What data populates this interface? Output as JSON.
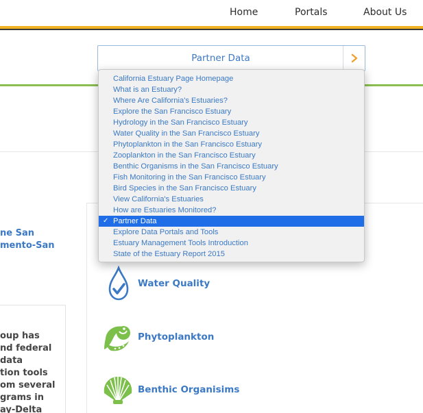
{
  "nav": {
    "home": "Home",
    "portals": "Portals",
    "about": "About Us"
  },
  "selector": {
    "label": "Partner Data",
    "arrow_icon": "chevron-right-icon",
    "arrow_color": "#f0a030"
  },
  "dropdown": {
    "options": [
      "California Estuary Page Homepage",
      "What is an Estuary?",
      "Where Are California's Estuaries?",
      "Explore the San Francisco Estuary",
      "Hydrology in the San Francisco Estuary",
      "Water Quality in the San Francisco Estuary",
      "Phytoplankton in the San Francisco Estuary",
      "Zooplankton in the San Francisco Estuary",
      "Benthic Organisms in the San Francisco Estuary",
      "Fish Monitoring in the San Francisco Estuary",
      "Bird Species in the San Francisco Estuary",
      "View California's Estuaries",
      "How are Estuaries Monitored?",
      "Partner Data",
      "Explore Data Portals and Tools",
      "Estuary Management Tools Introduction",
      "State of the Estuary Report 2015"
    ],
    "selected": "Partner Data",
    "check": "✓"
  },
  "left": {
    "heading_line1": "ne San",
    "heading_line2": "mento-San",
    "body_lines": [
      "oup has",
      "nd federal",
      "data",
      "tion tools",
      "om several",
      "grams in",
      "ay-Delta"
    ]
  },
  "card": {
    "items": [
      {
        "label": "Water Quality",
        "icon": "water-drop-check-icon"
      },
      {
        "label": "Phytoplankton",
        "icon": "phytoplankton-icon"
      },
      {
        "label": "Benthic Organisims",
        "icon": "scallop-shell-icon"
      }
    ]
  },
  "colors": {
    "accent_blue": "#3b79c4",
    "gold": "#f0b323",
    "green": "#8bbd4f",
    "selection": "#1f6ee8"
  }
}
